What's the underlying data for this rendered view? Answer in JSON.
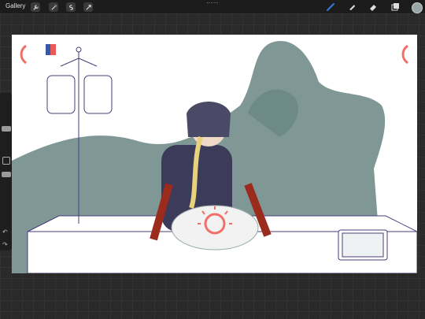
{
  "topbar": {
    "gallery_label": "Gallery",
    "left_tools": [
      "wrench-icon",
      "magic-wand-icon",
      "selection-icon",
      "transform-arrow-icon"
    ],
    "right_tools": [
      "brush-icon",
      "smudge-icon",
      "eraser-icon",
      "layers-icon",
      "color-swatch-icon"
    ],
    "active_tool_color": "#2f7bd9",
    "current_color": "#9aa6a6"
  },
  "canvas": {
    "artwork_description_icon": "artwork-illustration"
  },
  "colors": {
    "shadow_figure": "#7f9795",
    "outline": "#4a3d7a",
    "red_accent": "#f07068",
    "blood": "#b4472f"
  }
}
